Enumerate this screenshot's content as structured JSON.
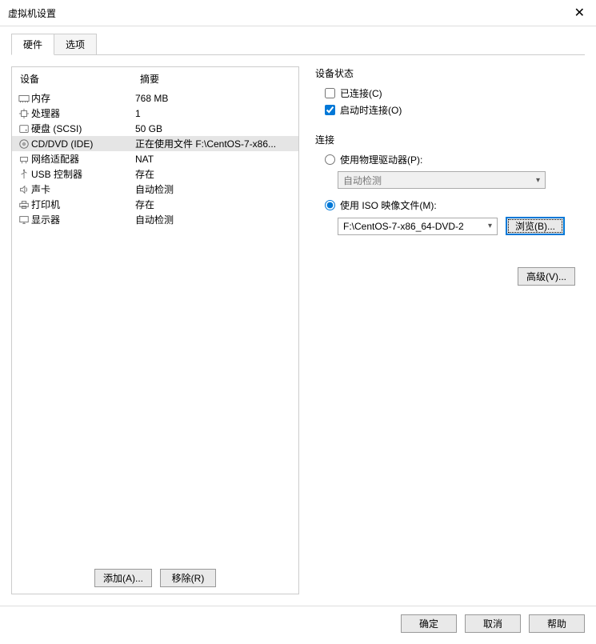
{
  "window": {
    "title": "虚拟机设置"
  },
  "tabs": {
    "hardware": "硬件",
    "options": "选项"
  },
  "headers": {
    "device": "设备",
    "summary": "摘要"
  },
  "hardware": [
    {
      "icon": "memory",
      "name": "内存",
      "summary": "768 MB",
      "selected": false
    },
    {
      "icon": "cpu",
      "name": "处理器",
      "summary": "1",
      "selected": false
    },
    {
      "icon": "disk",
      "name": "硬盘 (SCSI)",
      "summary": "50 GB",
      "selected": false
    },
    {
      "icon": "cd",
      "name": "CD/DVD (IDE)",
      "summary": "正在使用文件 F:\\CentOS-7-x86...",
      "selected": true
    },
    {
      "icon": "network",
      "name": "网络适配器",
      "summary": "NAT",
      "selected": false
    },
    {
      "icon": "usb",
      "name": "USB 控制器",
      "summary": "存在",
      "selected": false
    },
    {
      "icon": "sound",
      "name": "声卡",
      "summary": "自动检测",
      "selected": false
    },
    {
      "icon": "printer",
      "name": "打印机",
      "summary": "存在",
      "selected": false
    },
    {
      "icon": "display",
      "name": "显示器",
      "summary": "自动检测",
      "selected": false
    }
  ],
  "status": {
    "title": "设备状态",
    "connected": "已连接(C)",
    "connect_on_power": "启动时连接(O)"
  },
  "connection": {
    "title": "连接",
    "physical_label": "使用物理驱动器(P):",
    "physical_value": "自动检测",
    "iso_label": "使用 ISO 映像文件(M):",
    "iso_value": "F:\\CentOS-7-x86_64-DVD-2",
    "browse": "浏览(B)..."
  },
  "buttons": {
    "advanced": "高级(V)...",
    "add": "添加(A)...",
    "remove": "移除(R)",
    "ok": "确定",
    "cancel": "取消",
    "help": "帮助"
  }
}
